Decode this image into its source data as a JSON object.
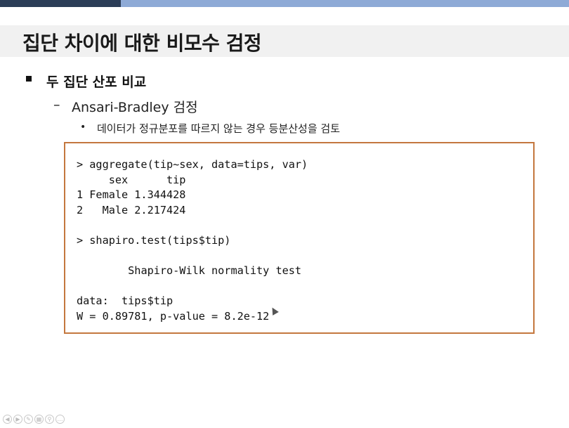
{
  "slide": {
    "title": "집단 차이에 대한 비모수 검정",
    "bullet1": "두 집단 산포 비교",
    "bullet2_dash": "–",
    "bullet2": "Ansari-Bradley  검정",
    "bullet3_dot": "•",
    "bullet3": "데이터가 정규분포를 따르지 않는 경우 등분산성을 검토"
  },
  "code": {
    "lines": "> aggregate(tip~sex, data=tips, var)\n     sex      tip\n1 Female 1.344428\n2   Male 2.217424\n\n> shapiro.test(tips$tip)\n\n\tShapiro-Wilk normality test\n\ndata:  tips$tip\nW = 0.89781, p-value = 8.2e-12"
  },
  "nav": {
    "icons": [
      "prev-icon",
      "next-icon",
      "pen-icon",
      "slides-icon",
      "zoom-icon",
      "more-icon"
    ],
    "glyphs": [
      "◀",
      "▶",
      "✎",
      "▦",
      "⚲",
      "…"
    ]
  },
  "colors": {
    "accent_dark": "#2b3d57",
    "accent_light": "#8eaad6",
    "code_border": "#c4773e"
  }
}
